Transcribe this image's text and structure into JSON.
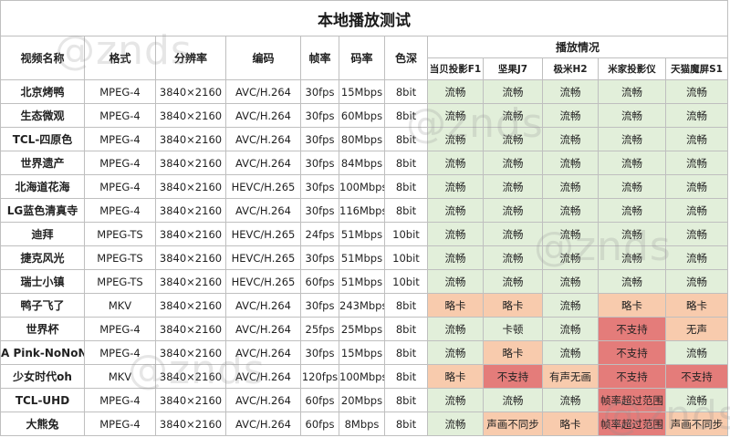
{
  "title": "本地播放测试",
  "headers": {
    "name": "视频名称",
    "format": "格式",
    "resolution": "分辨率",
    "codec": "编码",
    "fps": "帧率",
    "bitrate": "码率",
    "depth": "色深",
    "playback": "播放情况",
    "devices": [
      "当贝投影F1",
      "坚果J7",
      "极米H2",
      "米家投影仪",
      "天猫魔屏S1"
    ]
  },
  "watermark": "@znds",
  "colors": {
    "ok": "#e2efda",
    "lag": "#f8cbad",
    "fail": "#e47c7a"
  },
  "rows": [
    {
      "name": "北京烤鸭",
      "format": "MPEG-4",
      "resolution": "3840×2160",
      "codec": "AVC/H.264",
      "fps": "30fps",
      "bitrate": "15Mbps",
      "depth": "8bit",
      "results": [
        "流畅",
        "流畅",
        "流畅",
        "流畅",
        "流畅"
      ],
      "status": [
        "ok",
        "ok",
        "ok",
        "ok",
        "ok"
      ]
    },
    {
      "name": "生态微观",
      "format": "MPEG-4",
      "resolution": "3840×2160",
      "codec": "AVC/H.264",
      "fps": "30fps",
      "bitrate": "60Mbps",
      "depth": "8bit",
      "results": [
        "流畅",
        "流畅",
        "流畅",
        "流畅",
        "流畅"
      ],
      "status": [
        "ok",
        "ok",
        "ok",
        "ok",
        "ok"
      ]
    },
    {
      "name": "TCL-四原色",
      "format": "MPEG-4",
      "resolution": "3840×2160",
      "codec": "AVC/H.264",
      "fps": "30fps",
      "bitrate": "80Mbps",
      "depth": "8bit",
      "results": [
        "流畅",
        "流畅",
        "流畅",
        "流畅",
        "流畅"
      ],
      "status": [
        "ok",
        "ok",
        "ok",
        "ok",
        "ok"
      ]
    },
    {
      "name": "世界遗产",
      "format": "MPEG-4",
      "resolution": "3840×2160",
      "codec": "AVC/H.264",
      "fps": "30fps",
      "bitrate": "84Mbps",
      "depth": "8bit",
      "results": [
        "流畅",
        "流畅",
        "流畅",
        "流畅",
        "流畅"
      ],
      "status": [
        "ok",
        "ok",
        "ok",
        "ok",
        "ok"
      ]
    },
    {
      "name": "北海道花海",
      "format": "MPEG-4",
      "resolution": "3840×2160",
      "codec": "HEVC/H.265",
      "fps": "30fps",
      "bitrate": "100Mbps",
      "depth": "8bit",
      "results": [
        "流畅",
        "流畅",
        "流畅",
        "流畅",
        "流畅"
      ],
      "status": [
        "ok",
        "ok",
        "ok",
        "ok",
        "ok"
      ]
    },
    {
      "name": "LG蓝色清真寺",
      "format": "MPEG-4",
      "resolution": "3840×2160",
      "codec": "AVC/H.264",
      "fps": "30fps",
      "bitrate": "116Mbps",
      "depth": "8bit",
      "results": [
        "流畅",
        "流畅",
        "流畅",
        "流畅",
        "流畅"
      ],
      "status": [
        "ok",
        "ok",
        "ok",
        "ok",
        "ok"
      ]
    },
    {
      "name": "迪拜",
      "format": "MPEG-TS",
      "resolution": "3840×2160",
      "codec": "HEVC/H.265",
      "fps": "24fps",
      "bitrate": "51Mbps",
      "depth": "10bit",
      "results": [
        "流畅",
        "流畅",
        "流畅",
        "流畅",
        "流畅"
      ],
      "status": [
        "ok",
        "ok",
        "ok",
        "ok",
        "ok"
      ]
    },
    {
      "name": "捷克风光",
      "format": "MPEG-TS",
      "resolution": "3840×2160",
      "codec": "HEVC/H.265",
      "fps": "30fps",
      "bitrate": "51Mbps",
      "depth": "10bit",
      "results": [
        "流畅",
        "流畅",
        "流畅",
        "流畅",
        "流畅"
      ],
      "status": [
        "ok",
        "ok",
        "ok",
        "ok",
        "ok"
      ]
    },
    {
      "name": "瑞士小镇",
      "format": "MPEG-TS",
      "resolution": "3840×2160",
      "codec": "HEVC/H.265",
      "fps": "60fps",
      "bitrate": "51Mbps",
      "depth": "10bit",
      "results": [
        "流畅",
        "流畅",
        "流畅",
        "流畅",
        "流畅"
      ],
      "status": [
        "ok",
        "ok",
        "ok",
        "ok",
        "ok"
      ]
    },
    {
      "name": "鸭子飞了",
      "format": "MKV",
      "resolution": "3840×2160",
      "codec": "AVC/H.264",
      "fps": "30fps",
      "bitrate": "243Mbps",
      "depth": "8bit",
      "results": [
        "略卡",
        "略卡",
        "流畅",
        "略卡",
        "略卡"
      ],
      "status": [
        "lag",
        "lag",
        "ok",
        "lag",
        "lag"
      ]
    },
    {
      "name": "世界杯",
      "format": "MPEG-4",
      "resolution": "3840×2160",
      "codec": "AVC/H.264",
      "fps": "25fps",
      "bitrate": "25Mbps",
      "depth": "8bit",
      "results": [
        "流畅",
        "卡顿",
        "流畅",
        "不支持",
        "无声"
      ],
      "status": [
        "ok",
        "ok",
        "ok",
        "fail",
        "lag"
      ]
    },
    {
      "name": "A Pink-NoNoNo",
      "format": "MPEG-4",
      "resolution": "3840×2160",
      "codec": "AVC/H.264",
      "fps": "30fps",
      "bitrate": "15Mbps",
      "depth": "8bit",
      "results": [
        "流畅",
        "略卡",
        "流畅",
        "不支持",
        "流畅"
      ],
      "status": [
        "ok",
        "lag",
        "ok",
        "fail",
        "ok"
      ]
    },
    {
      "name": "少女时代oh",
      "format": "MKV",
      "resolution": "3840×2160",
      "codec": "AVC/H.264",
      "fps": "120fps",
      "bitrate": "100Mbps",
      "depth": "8bit",
      "results": [
        "略卡",
        "不支持",
        "有声无画",
        "不支持",
        "不支持"
      ],
      "status": [
        "lag",
        "fail",
        "lag",
        "fail",
        "fail"
      ]
    },
    {
      "name": "TCL-UHD",
      "format": "MPEG-4",
      "resolution": "3840×2160",
      "codec": "AVC/H.264",
      "fps": "60fps",
      "bitrate": "20Mbps",
      "depth": "8bit",
      "results": [
        "流畅",
        "流畅",
        "流畅",
        "帧率超过范围",
        "流畅"
      ],
      "status": [
        "ok",
        "ok",
        "ok",
        "fail",
        "ok"
      ]
    },
    {
      "name": "大熊兔",
      "format": "MPEG-4",
      "resolution": "3840×2160",
      "codec": "AVC/H.264",
      "fps": "60fps",
      "bitrate": "8Mbps",
      "depth": "8bit",
      "results": [
        "流畅",
        "声画不同步",
        "略卡",
        "帧率超过范围",
        "声画不同步"
      ],
      "status": [
        "ok",
        "lag",
        "lag",
        "fail",
        "lag"
      ]
    }
  ]
}
